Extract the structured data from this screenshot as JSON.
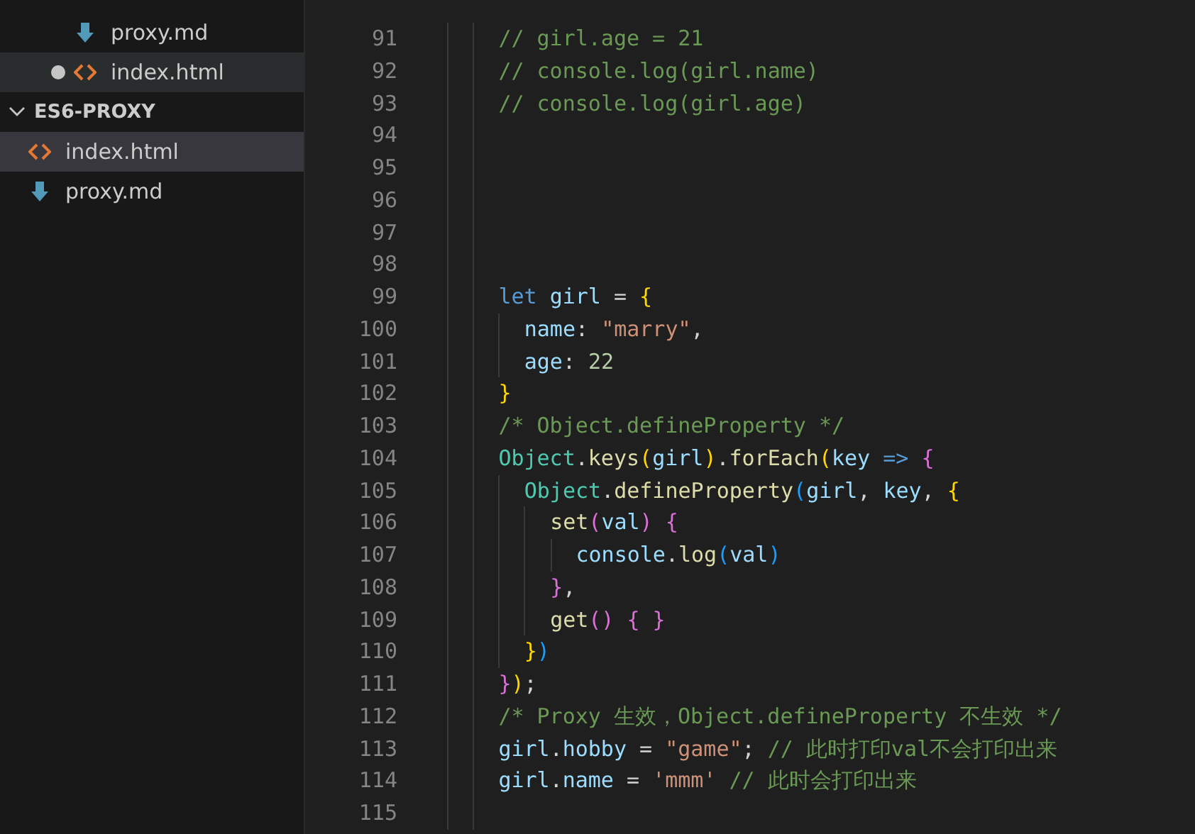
{
  "sidebar": {
    "open_files": [
      {
        "label": "proxy.md",
        "kind": "markdown",
        "modified": false,
        "selected": false
      },
      {
        "label": "index.html",
        "kind": "html",
        "modified": true,
        "selected": true
      }
    ],
    "folders": [
      {
        "label": "ES6-PROXY",
        "expanded": true,
        "children": [
          {
            "label": "index.html",
            "kind": "html",
            "selected": true
          },
          {
            "label": "proxy.md",
            "kind": "markdown",
            "selected": false
          }
        ]
      }
    ]
  },
  "editor": {
    "lines": [
      {
        "number": "91",
        "tokens": [
          {
            "kind": "comment",
            "text": "    // girl.age = 21"
          }
        ]
      },
      {
        "number": "92",
        "tokens": [
          {
            "kind": "comment",
            "text": "    // console.log(girl.name)"
          }
        ]
      },
      {
        "number": "93",
        "tokens": [
          {
            "kind": "comment",
            "text": "    // console.log(girl.age)"
          }
        ]
      },
      {
        "number": "94"
      },
      {
        "number": "95"
      },
      {
        "number": "96"
      },
      {
        "number": "97"
      },
      {
        "number": "98"
      },
      {
        "number": "99",
        "tokens": [
          {
            "kind": "keyword",
            "text": "    let "
          },
          {
            "kind": "var",
            "text": "girl"
          },
          {
            "kind": "punct",
            "text": " = "
          },
          {
            "kind": "b1",
            "text": "{"
          }
        ]
      },
      {
        "number": "100",
        "tokens": [
          {
            "kind": "var",
            "text": "      name"
          },
          {
            "kind": "punct",
            "text": ": "
          },
          {
            "kind": "str",
            "text": "\"marry\""
          },
          {
            "kind": "punct",
            "text": ","
          }
        ]
      },
      {
        "number": "101",
        "tokens": [
          {
            "kind": "var",
            "text": "      age"
          },
          {
            "kind": "punct",
            "text": ": "
          },
          {
            "kind": "num",
            "text": "22"
          }
        ]
      },
      {
        "number": "102",
        "tokens": [
          {
            "kind": "b1",
            "text": "    }"
          }
        ]
      },
      {
        "number": "103",
        "tokens": [
          {
            "kind": "comment",
            "text": "    /* Object.defineProperty */"
          }
        ]
      },
      {
        "number": "104",
        "tokens": [
          {
            "kind": "cls",
            "text": "    Object"
          },
          {
            "kind": "punct",
            "text": "."
          },
          {
            "kind": "fn",
            "text": "keys"
          },
          {
            "kind": "b1",
            "text": "("
          },
          {
            "kind": "var",
            "text": "girl"
          },
          {
            "kind": "b1",
            "text": ")"
          },
          {
            "kind": "punct",
            "text": "."
          },
          {
            "kind": "fn",
            "text": "forEach"
          },
          {
            "kind": "b1",
            "text": "("
          },
          {
            "kind": "var",
            "text": "key"
          },
          {
            "kind": "keyword",
            "text": " => "
          },
          {
            "kind": "b2",
            "text": "{"
          }
        ]
      },
      {
        "number": "105",
        "tokens": [
          {
            "kind": "cls",
            "text": "      Object"
          },
          {
            "kind": "punct",
            "text": "."
          },
          {
            "kind": "fn",
            "text": "defineProperty"
          },
          {
            "kind": "b3",
            "text": "("
          },
          {
            "kind": "var",
            "text": "girl"
          },
          {
            "kind": "punct",
            "text": ", "
          },
          {
            "kind": "var",
            "text": "key"
          },
          {
            "kind": "punct",
            "text": ", "
          },
          {
            "kind": "b1",
            "text": "{"
          }
        ]
      },
      {
        "number": "106",
        "tokens": [
          {
            "kind": "fn",
            "text": "        set"
          },
          {
            "kind": "b2",
            "text": "("
          },
          {
            "kind": "var",
            "text": "val"
          },
          {
            "kind": "b2",
            "text": ") {"
          }
        ]
      },
      {
        "number": "107",
        "tokens": [
          {
            "kind": "var",
            "text": "          console"
          },
          {
            "kind": "punct",
            "text": "."
          },
          {
            "kind": "fn",
            "text": "log"
          },
          {
            "kind": "b3",
            "text": "("
          },
          {
            "kind": "var",
            "text": "val"
          },
          {
            "kind": "b3",
            "text": ")"
          }
        ]
      },
      {
        "number": "108",
        "tokens": [
          {
            "kind": "b2",
            "text": "        }"
          },
          {
            "kind": "punct",
            "text": ","
          }
        ]
      },
      {
        "number": "109",
        "tokens": [
          {
            "kind": "fn",
            "text": "        get"
          },
          {
            "kind": "b2",
            "text": "() { }"
          }
        ]
      },
      {
        "number": "110",
        "tokens": [
          {
            "kind": "b1",
            "text": "      }"
          },
          {
            "kind": "b3",
            "text": ")"
          }
        ]
      },
      {
        "number": "111",
        "tokens": [
          {
            "kind": "b2",
            "text": "    }"
          },
          {
            "kind": "b1",
            "text": ")"
          },
          {
            "kind": "punct",
            "text": ";"
          }
        ]
      },
      {
        "number": "112",
        "tokens": [
          {
            "kind": "comment",
            "text": "    /* Proxy 生效，Object.defineProperty 不生效 */"
          }
        ]
      },
      {
        "number": "113",
        "tokens": [
          {
            "kind": "var",
            "text": "    girl"
          },
          {
            "kind": "punct",
            "text": "."
          },
          {
            "kind": "var",
            "text": "hobby"
          },
          {
            "kind": "punct",
            "text": " = "
          },
          {
            "kind": "str",
            "text": "\"game\""
          },
          {
            "kind": "punct",
            "text": "; "
          },
          {
            "kind": "comment",
            "text": "// 此时打印val不会打印出来"
          }
        ]
      },
      {
        "number": "114",
        "tokens": [
          {
            "kind": "var",
            "text": "    girl"
          },
          {
            "kind": "punct",
            "text": "."
          },
          {
            "kind": "var",
            "text": "name"
          },
          {
            "kind": "punct",
            "text": " = "
          },
          {
            "kind": "str",
            "text": "'mmm' "
          },
          {
            "kind": "comment",
            "text": "// 此时会打印出来"
          }
        ]
      },
      {
        "number": "115"
      }
    ]
  }
}
